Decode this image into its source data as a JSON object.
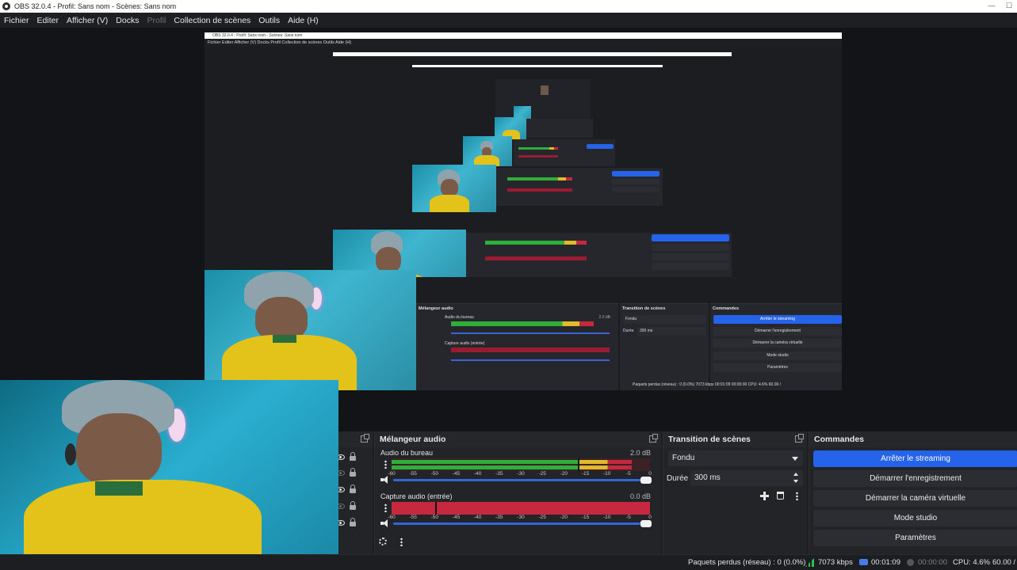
{
  "window": {
    "title": "OBS 32.0.4 - Profil: Sans nom - Scènes: Sans nom",
    "minimize": "—",
    "maximize": "☐"
  },
  "menu": [
    "Fichier",
    "Editer",
    "Afficher (V)",
    "Docks",
    "Profil",
    "Collection de scènes",
    "Outils",
    "Aide (H)"
  ],
  "nested": {
    "title": "OBS 32.0.4 - Profil: Sans nom - Scènes: Sans nom",
    "menu": "Fichier  Editer  Afficher (V)  Docks  Profil  Collection de scènes  Outils  Aide (H)",
    "mixer_title": "Mélangeur audio",
    "transition_title": "Transition de scènes",
    "commands_title": "Commandes",
    "desktop": "Audio du bureau",
    "desktop_db": "2.0 dB",
    "capture": "Capture audio (entrée)",
    "fade": "Fondu",
    "duration": "Durée",
    "duration_val": "300 ms",
    "buttons": [
      "Arrêter le streaming",
      "Démarrer l'enregistrement",
      "Démarrer la caméra virtuelle",
      "Mode studio",
      "Paramètres"
    ],
    "status": "Paquets perdus (réseau) : 0 (0.0%)   7073 kbps   00:01:09   00:00:00   CPU: 4.6%   60.00 /"
  },
  "sources": {
    "rows": [
      {
        "visible": true
      },
      {
        "visible": false
      },
      {
        "visible": true
      },
      {
        "visible": false
      },
      {
        "visible": true
      }
    ]
  },
  "mixer": {
    "title": "Mélangeur audio",
    "scale": [
      "-60",
      "-55",
      "-50",
      "-45",
      "-40",
      "-35",
      "-30",
      "-25",
      "-20",
      "-15",
      "-10",
      "-5",
      "0"
    ],
    "channels": [
      {
        "name": "Audio du bureau",
        "db": "2.0 dB",
        "level_fraction": 0.93,
        "peak_fraction": 0.72,
        "volume_fraction": 1.0
      },
      {
        "name": "Capture audio (entrée)",
        "db": "0.0 dB",
        "level_fraction": 0.0,
        "peak_fraction": 0.17,
        "volume_fraction": 1.0
      }
    ]
  },
  "transition": {
    "title": "Transition de scènes",
    "type": "Fondu",
    "duration_label": "Durée",
    "duration_value": "300 ms"
  },
  "controls": {
    "title": "Commandes",
    "buttons": [
      "Arrêter le streaming",
      "Démarrer l'enregistrement",
      "Démarrer la caméra virtuelle",
      "Mode studio",
      "Paramètres"
    ]
  },
  "status": {
    "dropped": "Paquets perdus (réseau) : 0 (0.0%)",
    "bitrate": "7073 kbps",
    "stream_time": "00:01:09",
    "rec_time": "00:00:00",
    "cpu": "CPU: 4.6%",
    "fps": "60.00 /"
  },
  "colors": {
    "accent": "#2563eb",
    "meter_green": "#2faf3a",
    "meter_yellow": "#e1b92a",
    "meter_red": "#c6283f"
  }
}
